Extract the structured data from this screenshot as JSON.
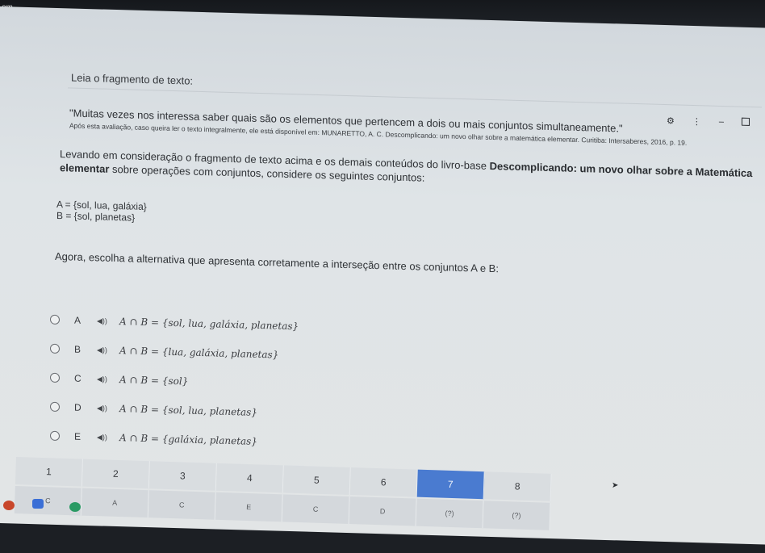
{
  "screen_label": "om",
  "intro": "Leia o fragmento de texto:",
  "quote": "\"Muitas vezes nos interessa saber quais são os elementos que pertencem a dois ou mais conjuntos simultaneamente.\"",
  "reference": "Após esta avaliação, caso queira ler o texto integralmente, ele está disponível em: MUNARETTO, A. C. Descomplicando: um novo olhar sobre a matemática elementar. Curitiba: Intersaberes, 2016, p. 19.",
  "prompt": {
    "before": "Levando em consideração o fragmento de texto acima e os demais conteúdos do livro-base ",
    "bold": "Descomplicando: um novo olhar sobre a Matemática elementar",
    "after": " sobre operações com conjuntos, considere os seguintes conjuntos:"
  },
  "sets": {
    "a": "A = {sol, lua, galáxia}",
    "b": "B = {sol, planetas}"
  },
  "task": "Agora, escolha a alternativa que apresenta corretamente a interseção entre os conjuntos A e B:",
  "speaker_glyph": "◀))",
  "options": [
    {
      "letter": "A",
      "formula": "A ∩ B = {sol, lua, galáxia, planetas}"
    },
    {
      "letter": "B",
      "formula": "A ∩ B = {lua, galáxia, planetas}"
    },
    {
      "letter": "C",
      "formula": "A ∩ B = {sol}"
    },
    {
      "letter": "D",
      "formula": "A ∩ B = {sol, lua, planetas}"
    },
    {
      "letter": "E",
      "formula": "A ∩ B = {galáxia, planetas}"
    }
  ],
  "top_icons": [
    "⚙",
    "⋮",
    "–"
  ],
  "pager": {
    "numbers": [
      "1",
      "2",
      "3",
      "4",
      "5",
      "6",
      "7",
      "8"
    ],
    "answers": [
      "C",
      "A",
      "C",
      "E",
      "C",
      "D",
      "(?)",
      "(?)"
    ],
    "active_index": 6
  },
  "colors": {
    "background": "#e0e4e6",
    "active_page": "#4a7bd0"
  }
}
